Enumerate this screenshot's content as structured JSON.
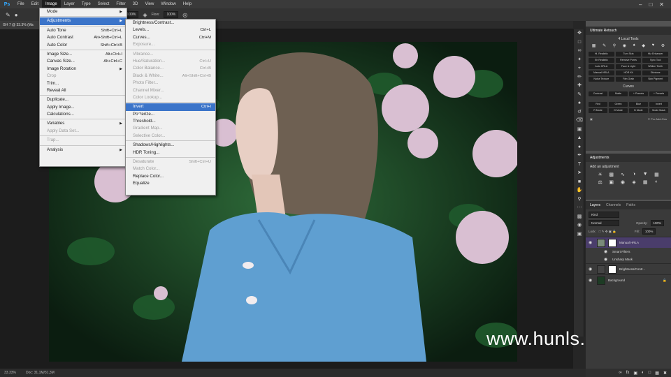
{
  "menubar": {
    "logo": "Ps",
    "items": [
      "File",
      "Edit",
      "Image",
      "Layer",
      "Type",
      "Select",
      "Filter",
      "3D",
      "View",
      "Window",
      "Help"
    ]
  },
  "optionsbar": {
    "zoom1_value": "100%",
    "flow_label": "Flow:",
    "flow_value": "100%"
  },
  "document": {
    "tab_title": "GH 7 @ 33.3% (Ma"
  },
  "image_menu": {
    "items": [
      {
        "label": "Mode",
        "shortcut": "",
        "arrow": true,
        "disabled": false,
        "sep_after": true
      },
      {
        "label": "Adjustments",
        "shortcut": "",
        "arrow": true,
        "disabled": false,
        "highlight": true,
        "sep_after": true
      },
      {
        "label": "Auto Tone",
        "shortcut": "Shift+Ctrl+L",
        "disabled": false
      },
      {
        "label": "Auto Contrast",
        "shortcut": "Alt+Shift+Ctrl+L",
        "disabled": false
      },
      {
        "label": "Auto Color",
        "shortcut": "Shift+Ctrl+B",
        "disabled": false,
        "sep_after": true
      },
      {
        "label": "Image Size...",
        "shortcut": "Alt+Ctrl+I",
        "disabled": false
      },
      {
        "label": "Canvas Size...",
        "shortcut": "Alt+Ctrl+C",
        "disabled": false
      },
      {
        "label": "Image Rotation",
        "shortcut": "",
        "arrow": true,
        "disabled": false
      },
      {
        "label": "Crop",
        "shortcut": "",
        "disabled": true
      },
      {
        "label": "Trim...",
        "shortcut": "",
        "disabled": false
      },
      {
        "label": "Reveal All",
        "shortcut": "",
        "disabled": false,
        "sep_after": true
      },
      {
        "label": "Duplicate...",
        "shortcut": "",
        "disabled": false
      },
      {
        "label": "Apply Image...",
        "shortcut": "",
        "disabled": false
      },
      {
        "label": "Calculations...",
        "shortcut": "",
        "disabled": false,
        "sep_after": true
      },
      {
        "label": "Variables",
        "shortcut": "",
        "arrow": true,
        "disabled": false
      },
      {
        "label": "Apply Data Set...",
        "shortcut": "",
        "disabled": true,
        "sep_after": true
      },
      {
        "label": "Trap...",
        "shortcut": "",
        "disabled": true,
        "sep_after": true
      },
      {
        "label": "Analysis",
        "shortcut": "",
        "arrow": true,
        "disabled": false
      }
    ]
  },
  "adjustments_menu": {
    "items": [
      {
        "label": "Brightness/Contrast...",
        "shortcut": "",
        "disabled": false
      },
      {
        "label": "Levels...",
        "shortcut": "Ctrl+L",
        "disabled": false
      },
      {
        "label": "Curves...",
        "shortcut": "Ctrl+M",
        "disabled": false
      },
      {
        "label": "Exposure...",
        "shortcut": "",
        "disabled": true,
        "sep_after": true
      },
      {
        "label": "Vibrance...",
        "shortcut": "",
        "disabled": true
      },
      {
        "label": "Hue/Saturation...",
        "shortcut": "Ctrl+U",
        "disabled": true
      },
      {
        "label": "Color Balance...",
        "shortcut": "Ctrl+B",
        "disabled": true
      },
      {
        "label": "Black & White...",
        "shortcut": "Alt+Shift+Ctrl+B",
        "disabled": true
      },
      {
        "label": "Photo Filter...",
        "shortcut": "",
        "disabled": true
      },
      {
        "label": "Channel Mixer...",
        "shortcut": "",
        "disabled": true
      },
      {
        "label": "Color Lookup...",
        "shortcut": "",
        "disabled": true,
        "sep_after": true
      },
      {
        "label": "Invert",
        "shortcut": "Ctrl+I",
        "disabled": false,
        "highlight": true
      },
      {
        "label": "Posterize...",
        "shortcut": "",
        "disabled": false
      },
      {
        "label": "Threshold...",
        "shortcut": "",
        "disabled": false
      },
      {
        "label": "Gradient Map...",
        "shortcut": "",
        "disabled": true
      },
      {
        "label": "Selective Color...",
        "shortcut": "",
        "disabled": true,
        "sep_after": true
      },
      {
        "label": "Shadows/Highlights...",
        "shortcut": "",
        "disabled": false
      },
      {
        "label": "HDR Toning...",
        "shortcut": "",
        "disabled": false,
        "sep_after": true
      },
      {
        "label": "Desaturate",
        "shortcut": "Shift+Ctrl+U",
        "disabled": true
      },
      {
        "label": "Match Color...",
        "shortcut": "",
        "disabled": true
      },
      {
        "label": "Replace Color...",
        "shortcut": "",
        "disabled": false
      },
      {
        "label": "Equalize",
        "shortcut": "",
        "disabled": false
      }
    ]
  },
  "retouch_panel": {
    "title": "Ultimate Retouch",
    "subtitle": "4 Local Tools",
    "buttons": [
      "Hi. Realistic",
      "Tum Skin",
      "Hiz Enhancer",
      "Sh Realistic",
      "Remove Pores",
      "Sync Tool",
      "Auto HRLA",
      "Face & Light",
      "Whiten Teeth",
      "Manual HRLA",
      "HDR Kit",
      "Skintone",
      "Noise Texture",
      "Film Grain",
      "Skin Pigment"
    ],
    "curves_title": "Curves",
    "curves_buttons": [
      "Contrast",
      "Matte",
      "+ Presets",
      "+ Presets"
    ],
    "color_buttons": [
      "Red",
      "Green",
      "Blue",
      "Invert",
      "R Mode",
      "G Mode",
      "B Mode",
      "Mode Mask"
    ],
    "footer_right": "© Pro Add-Ons"
  },
  "adjustments_panel": {
    "title": "Adjustments",
    "hint": "Add an adjustment"
  },
  "layers_panel": {
    "tabs": [
      "Layers",
      "Channels",
      "Paths"
    ],
    "kind_label": "Kind",
    "blend_mode": "Normal",
    "opacity_label": "Opacity:",
    "opacity_value": "100%",
    "lock_label": "Lock:",
    "fill_label": "Fill:",
    "fill_value": "100%",
    "layers": [
      {
        "name": "Manual HRLA",
        "selected": true
      },
      {
        "name": "Smart Filters",
        "sub": true
      },
      {
        "name": "Unsharp Mask",
        "sub": true
      },
      {
        "name": "Brightness/Contr...",
        "selected": false
      },
      {
        "name": "Background",
        "selected": false
      }
    ]
  },
  "statusbar": {
    "zoom": "33.33%",
    "doc": "Doc: 31,1M/31,3M"
  },
  "watermark": "www.hunls.com",
  "colors": {
    "menu_highlight": "#3b74c9",
    "layer_selected": "#4a3d6b"
  }
}
